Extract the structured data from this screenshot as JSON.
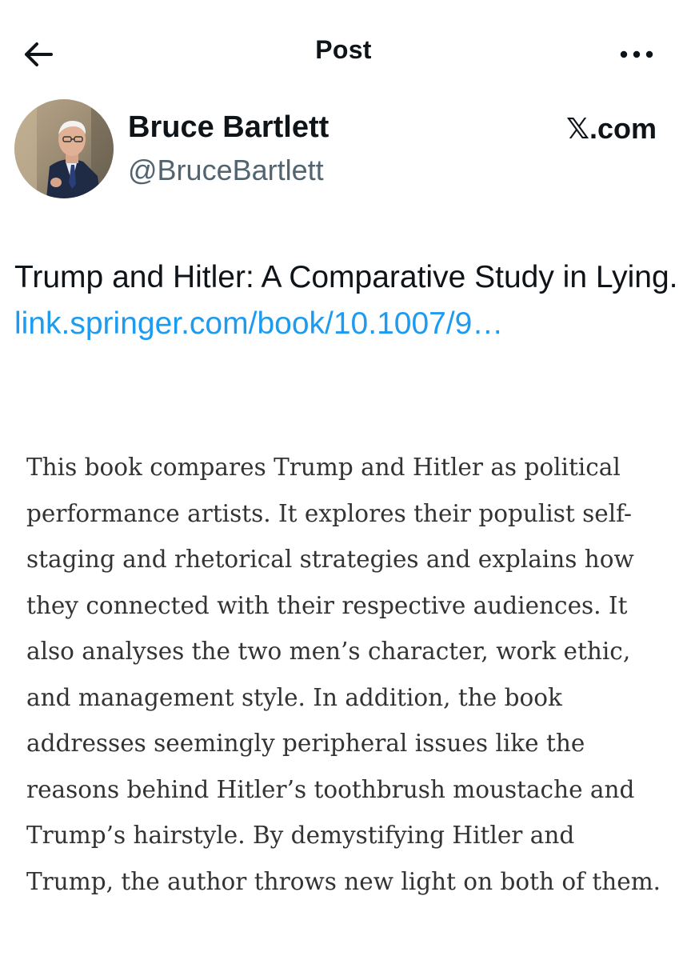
{
  "header": {
    "title": "Post",
    "back_icon": "arrow-left-icon",
    "more_icon": "more-horizontal-icon"
  },
  "author": {
    "name": "Bruce Bartlett",
    "handle": "@BruceBartlett",
    "source": "𝕏.com"
  },
  "tweet": {
    "text": "Trump and Hitler: A Comparative Study in Lying.",
    "link_text": "link.springer.com/book/10.1007/9…"
  },
  "attachment": {
    "description": "This book compares Trump and Hitler as political performance artists. It explores their populist self-staging and rhetorical strategies and explains how they connected with their respective audiences. It also analyses the two men’s character, work ethic, and management style. In addition, the book addresses seemingly peripheral issues like the reasons behind Hitler’s toothbrush moustache and Trump’s hairstyle. By demystifying Hitler and Trump, the author throws new light on both of them."
  },
  "colors": {
    "text": "#0f1419",
    "secondary": "#536471",
    "link": "#1d9bf0",
    "description_text": "#333333"
  }
}
